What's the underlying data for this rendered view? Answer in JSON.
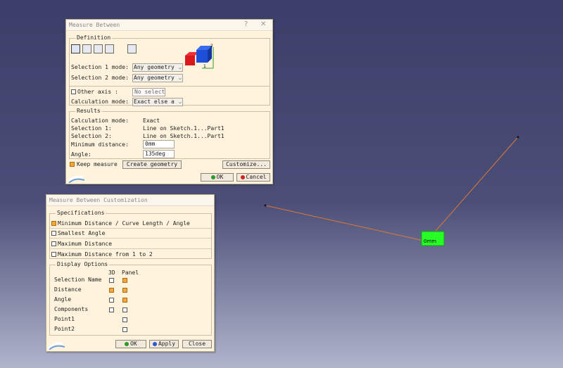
{
  "measure": {
    "title": "Measure Between",
    "help_btn": "?",
    "close_btn": "✕",
    "definition_title": "Definition",
    "sel1_label": "Selection 1 mode:",
    "sel1_value": "Any geometry",
    "sel2_label": "Selection 2 mode:",
    "sel2_value": "Any geometry",
    "other_axis_label": "Other axis :",
    "other_axis_value": "No select",
    "calc_mode_label": "Calculation mode:",
    "calc_mode_value": "Exact else a",
    "results_title": "Results",
    "results": [
      {
        "label": "Calculation mode:",
        "value": "Exact"
      },
      {
        "label": "Selection 1:",
        "value": "Line on Sketch.1...Part1"
      },
      {
        "label": "Selection 2:",
        "value": "Line on Sketch.1...Part1"
      }
    ],
    "min_dist_label": "Minimum distance:",
    "min_dist_value": "0mm",
    "angle_label": "Angle:",
    "angle_value": "135deg",
    "keep_measure_label": "Keep measure",
    "keep_measure_checked": true,
    "create_geometry": "Create geometry",
    "customize": "Customize...",
    "ok": "OK",
    "cancel": "Cancel"
  },
  "custom": {
    "title": "Measure Between Customization",
    "specs_title": "Specifications",
    "specs": [
      {
        "label": "Minimum Distance / Curve Length / Angle",
        "checked": true
      },
      {
        "label": "Smallest Angle",
        "checked": false
      },
      {
        "label": "Maximum Distance",
        "checked": false
      },
      {
        "label": "Maximum Distance from 1 to 2",
        "checked": false
      }
    ],
    "display_title": "Display Options",
    "col_3d": "3D",
    "col_panel": "Panel",
    "rows": [
      {
        "label": "Selection Name",
        "d3": false,
        "panel": true
      },
      {
        "label": "Distance",
        "d3": true,
        "panel": true
      },
      {
        "label": "Angle",
        "d3": false,
        "panel": true
      },
      {
        "label": "Components",
        "d3": false,
        "panel": false
      },
      {
        "label": "Point1",
        "d3": null,
        "panel": false
      },
      {
        "label": "Point2",
        "d3": null,
        "panel": false
      }
    ],
    "ok": "OK",
    "apply": "Apply",
    "close": "Close"
  },
  "viewport": {
    "measure_label": "0mm"
  },
  "colors": {
    "background_top": "#3a3e68",
    "background_bottom": "#b0b4cb",
    "dialog_bg": "#fff3dd",
    "line": "#e07830",
    "label_bg": "#27ff27",
    "check_on": "#f1a640"
  }
}
